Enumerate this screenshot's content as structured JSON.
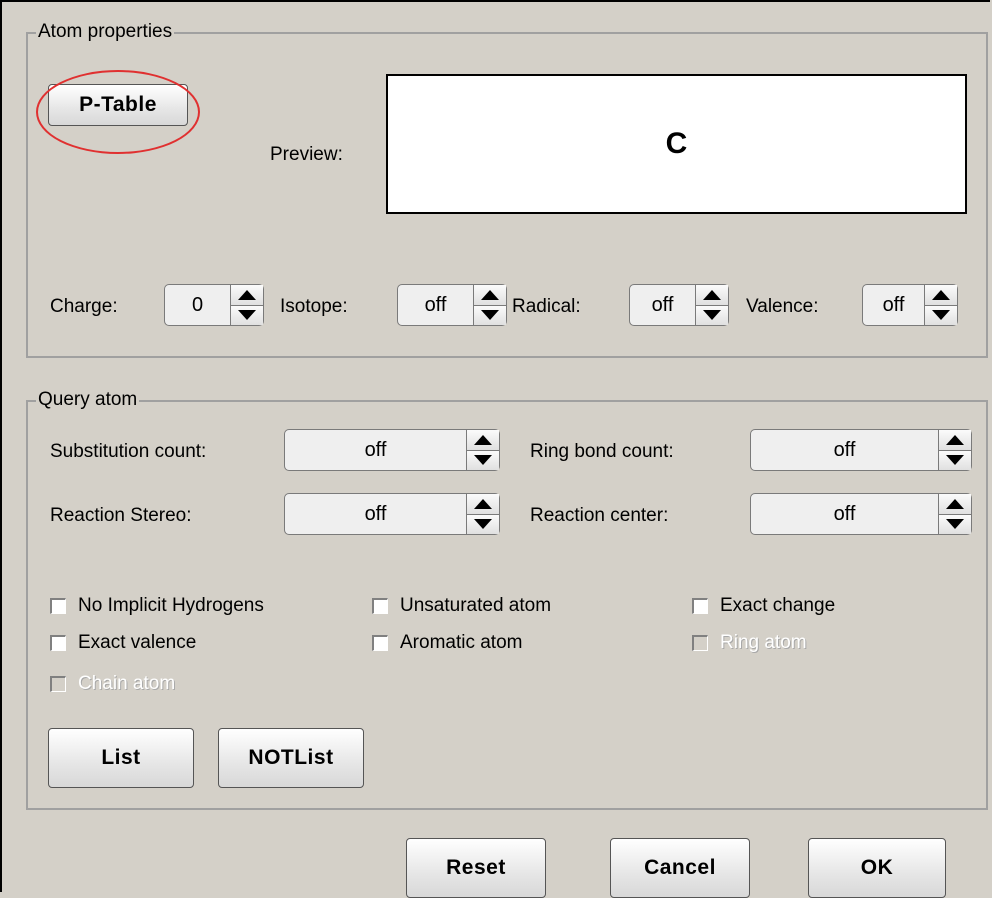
{
  "atom_properties": {
    "legend": "Atom properties",
    "ptable_label": "P-Table",
    "preview_label": "Preview:",
    "preview_value": "C",
    "charge": {
      "label": "Charge:",
      "value": "0"
    },
    "isotope": {
      "label": "Isotope:",
      "value": "off"
    },
    "radical": {
      "label": "Radical:",
      "value": "off"
    },
    "valence": {
      "label": "Valence:",
      "value": "off"
    }
  },
  "query_atom": {
    "legend": "Query atom",
    "substitution_count": {
      "label": "Substitution count:",
      "value": "off"
    },
    "ring_bond_count": {
      "label": "Ring bond count:",
      "value": "off"
    },
    "reaction_stereo": {
      "label": "Reaction Stereo:",
      "value": "off"
    },
    "reaction_center": {
      "label": "Reaction center:",
      "value": "off"
    },
    "checkboxes": {
      "no_implicit_h": "No Implicit Hydrogens",
      "unsaturated_atom": "Unsaturated atom",
      "exact_change": "Exact change",
      "exact_valence": "Exact valence",
      "aromatic_atom": "Aromatic atom",
      "ring_atom": "Ring atom",
      "chain_atom": "Chain atom"
    },
    "list_label": "List",
    "notlist_label": "NOTList"
  },
  "footer": {
    "reset_label": "Reset",
    "cancel_label": "Cancel",
    "ok_label": "OK"
  },
  "colors": {
    "background": "#d4d0c8",
    "highlight_ellipse": "#e03030"
  }
}
